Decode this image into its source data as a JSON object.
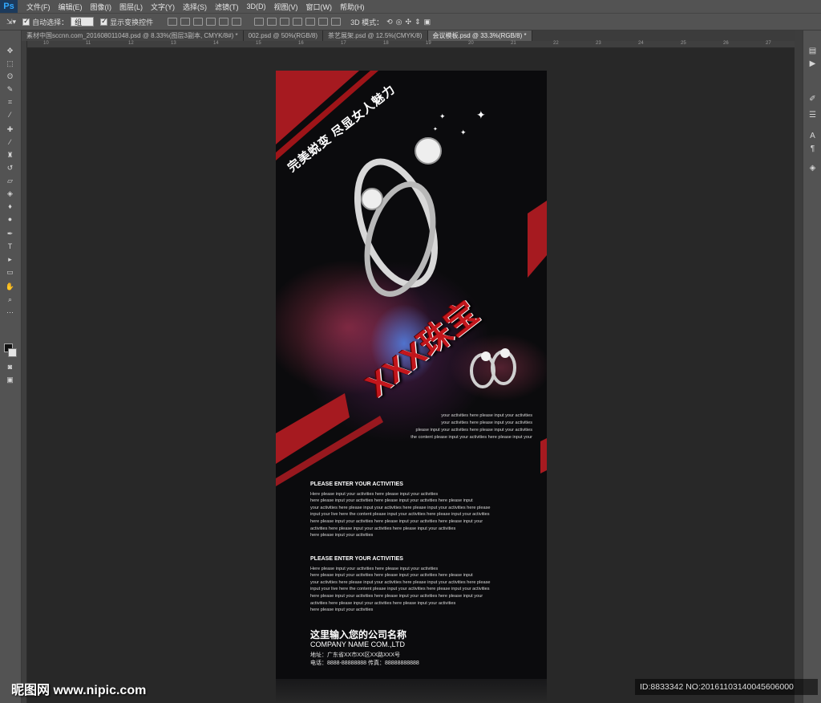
{
  "menubar": {
    "logo": "Ps",
    "items": [
      "文件(F)",
      "编辑(E)",
      "图像(I)",
      "图层(L)",
      "文字(Y)",
      "选择(S)",
      "滤镜(T)",
      "3D(D)",
      "视图(V)",
      "窗口(W)",
      "帮助(H)"
    ]
  },
  "options": {
    "auto_select_label": "自动选择：",
    "auto_select_value": "组",
    "show_transform_label": "显示变换控件",
    "mode_3d_label": "3D 模式："
  },
  "tabs": [
    "素材中国sccnn.com_201608011048.psd @ 8.33%(图层3副本, CMYK/8#) *",
    "002.psd @ 50%(RGB/8)",
    "茶艺展架.psd @ 12.5%(CMYK/8)",
    "会议模板.psd @ 33.3%(RGB/8) *"
  ],
  "ruler_numbers": [
    "10",
    "11",
    "12",
    "13",
    "14",
    "15",
    "16",
    "17",
    "18",
    "19",
    "20",
    "21",
    "22",
    "23",
    "24",
    "25",
    "26",
    "27"
  ],
  "poster": {
    "slogan": "完美蜕变  尽显女人魅力",
    "brand": "XXX珠宝",
    "intro_lines": [
      "your activities here please input your activities",
      "your activities here please input your activities",
      "please input your activities here please input your activities",
      "the content please input your activities here please input your"
    ],
    "block1_title": "PLEASE ENTER YOUR ACTIVITIES",
    "block1_lines": [
      "Here please input your activities here please input your activities",
      "here please input your activities here please input your activities here please input",
      "your activities here please input your activities here please input your activities here please",
      "input your live here the content please input your activities here please input your activities",
      "here please input your activities here please input your activities here please input your",
      "activities here please input your activities here please input your activities",
      "here please input your activities"
    ],
    "block2_title": "PLEASE ENTER YOUR ACTIVITIES",
    "block2_lines": [
      "Here please input your activities here please input your activities",
      "here please input your activities here please input your activities here please input",
      "your activities here please input your activities here please input your activities here please",
      "input your live here the content please input your activities here please input your activities",
      "here please input your activities here please input your activities here please input your",
      "activities here please input your activities here please input your activities",
      "here please input your activities"
    ],
    "company_cn": "这里输入您的公司名称",
    "company_en": "COMPANY NAME COM.,LTD",
    "address": "地址：广东省XX市XX区XX路XXX号",
    "phone": "电话：8888-88888888  传真：88888888888"
  },
  "watermark": {
    "logo_text": "昵图网 www.nipic.com",
    "id_text": "ID:8833342 NO:20161103140045606000"
  },
  "colors": {
    "accent_red": "#c3161c",
    "poster_bg": "#0b0b0d",
    "app_bg": "#282828"
  }
}
